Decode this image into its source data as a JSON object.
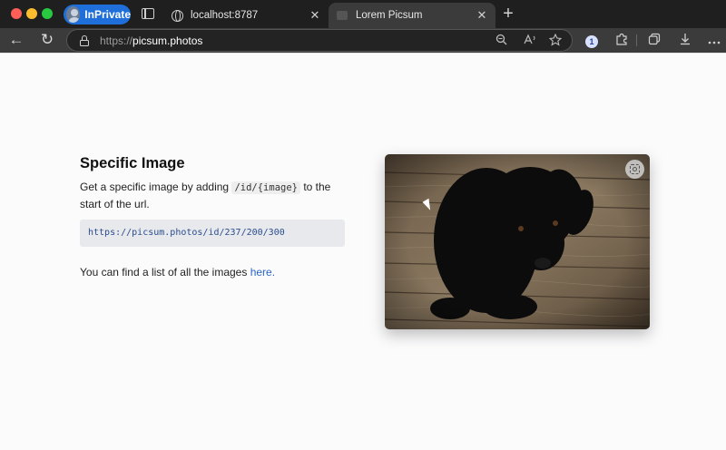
{
  "tabs": {
    "inprivate_label": "InPrivate",
    "tab1": {
      "title": "localhost:8787",
      "close": "✕"
    },
    "tab2": {
      "title": "Lorem Picsum",
      "close": "✕"
    },
    "new_tab": "+"
  },
  "toolbar": {
    "url_scheme": "https://",
    "url_host": "picsum.photos",
    "back_glyph": "←",
    "reload_glyph": "↻"
  },
  "page": {
    "heading": "Specific Image",
    "desc_before": "Get a specific image by adding",
    "desc_code": "/id/{image}",
    "desc_after": "to the start of the url.",
    "example_url": "https://picsum.photos/id/237/200/300",
    "list_text": "You can find a list of all the images",
    "list_link": "here."
  },
  "icons": {
    "tab_actions": "tab-actions-icon",
    "globe": "globe-icon",
    "lock": "lock-icon",
    "zoom": "zoom-icon",
    "read_aloud": "read-aloud-icon",
    "favorite": "star-icon",
    "password": "password-manager-icon",
    "extensions": "puzzle-icon",
    "collections": "collections-icon",
    "downloads": "download-icon",
    "more": "more-icon",
    "visual_search": "visual-search-icon"
  },
  "colors": {
    "accent": "#1e6fd9",
    "link": "#2a65c6"
  }
}
